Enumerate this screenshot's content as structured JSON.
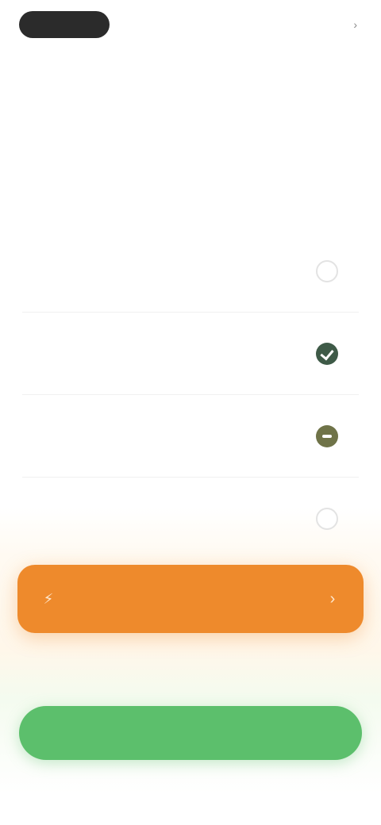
{
  "header": {
    "logo_label": "",
    "link_label": ""
  },
  "headline": "",
  "options": [
    {
      "title": "",
      "subtitle": "",
      "state": "unchecked"
    },
    {
      "title": "",
      "subtitle": "",
      "state": "selected"
    },
    {
      "title": "",
      "subtitle": "",
      "state": "partial"
    },
    {
      "title": "",
      "subtitle": "",
      "state": "unchecked"
    }
  ],
  "promo": {
    "label": "",
    "icon": "bolt-icon",
    "chevron": "chevron-right-icon"
  },
  "primary_button": {
    "label": ""
  },
  "colors": {
    "accent_orange": "#ee8a2c",
    "accent_green": "#5cbf6c",
    "check_selected": "#3e5a47",
    "check_partial": "#6f7348"
  }
}
